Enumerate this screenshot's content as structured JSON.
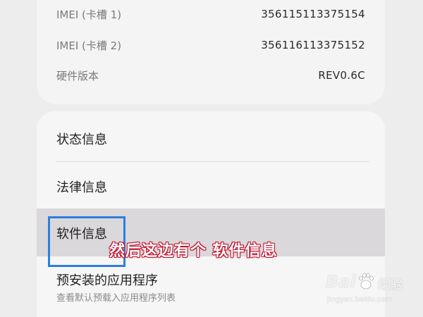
{
  "device_info": {
    "rows": [
      {
        "label": "IMEI (卡槽 1)",
        "value": "356115113375154"
      },
      {
        "label": "IMEI (卡槽 2)",
        "value": "356116113375152"
      },
      {
        "label": "硬件版本",
        "value": "REV0.6C"
      }
    ]
  },
  "menu": {
    "items": [
      {
        "label": "状态信息"
      },
      {
        "label": "法律信息"
      },
      {
        "label": "软件信息"
      },
      {
        "label": "预安装的应用程序",
        "sub": "查看默认预载入应用程序列表"
      }
    ]
  },
  "caption": "然后这边有个 软件信息",
  "watermark": {
    "logo": "Bai",
    "text": "经验",
    "url": "jingyan.baidu.com"
  },
  "colors": {
    "highlight_box": "#2a7fe0",
    "caption_outline": "#c0112b",
    "selected_row": "#dad8da"
  }
}
